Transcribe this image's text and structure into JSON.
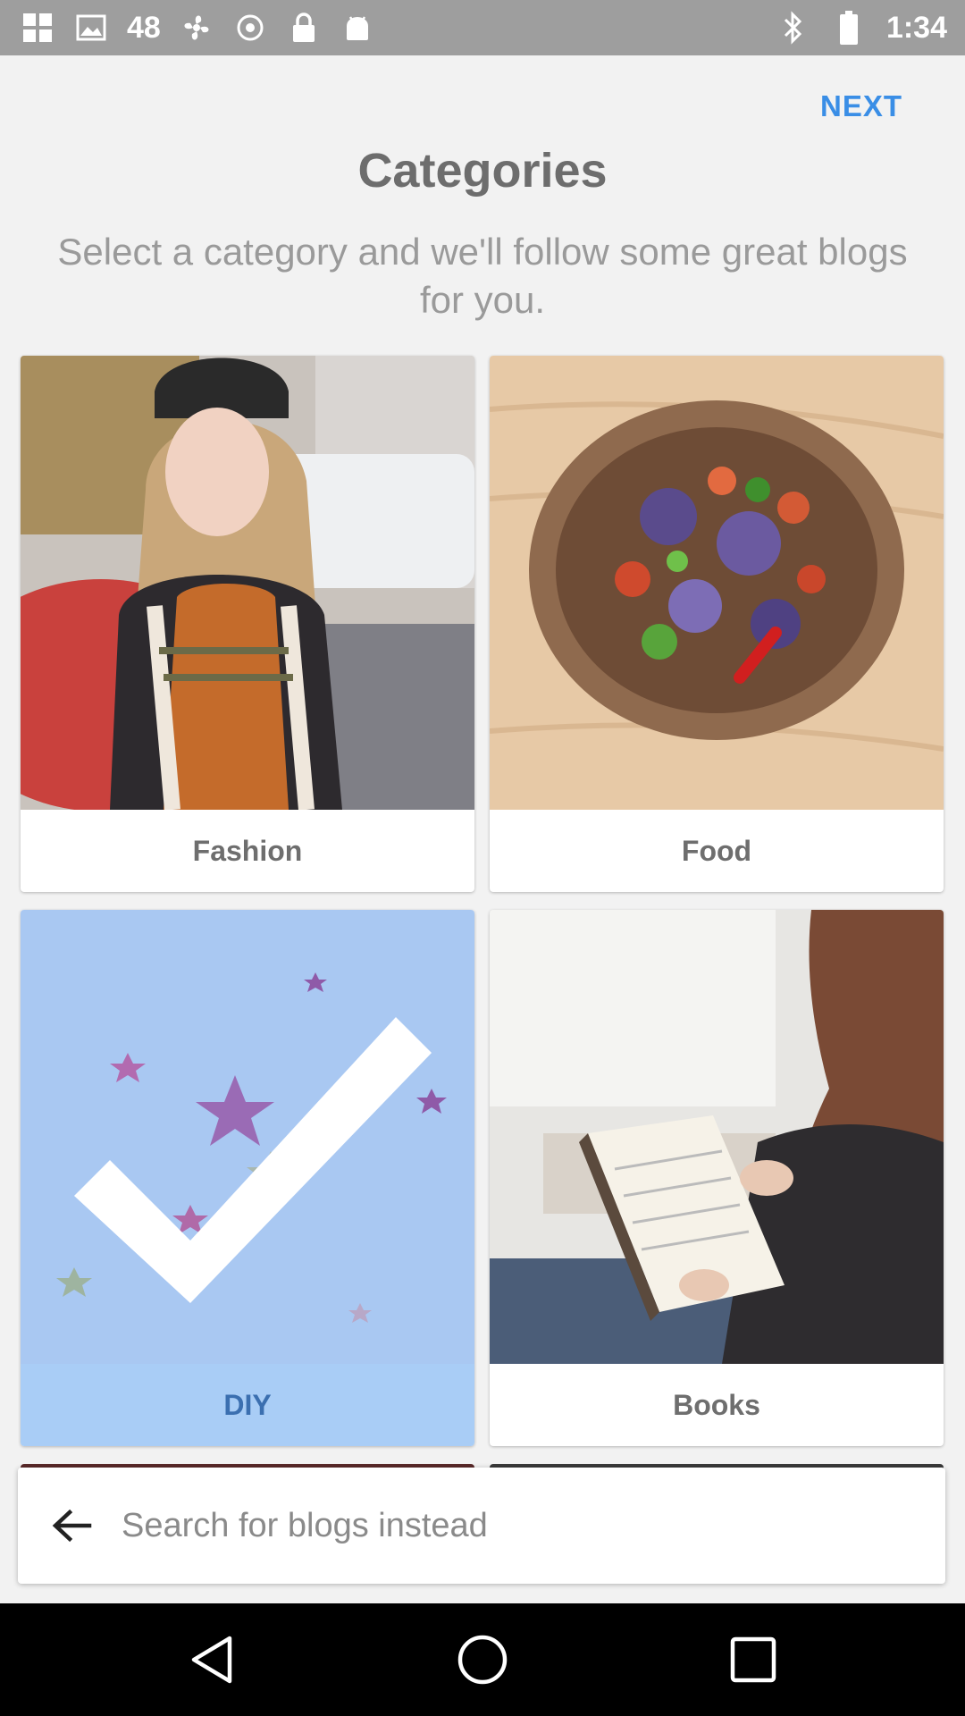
{
  "status_bar": {
    "left_text": "48",
    "time": "1:34",
    "icons": [
      "grid-icon",
      "picture-icon",
      "fan-icon",
      "location-icon",
      "lock-icon",
      "android-icon",
      "bluetooth-icon",
      "battery-icon"
    ]
  },
  "header": {
    "next_label": "NEXT",
    "title": "Categories",
    "subtitle": "Select a category and we'll follow some great blogs for you."
  },
  "categories": [
    {
      "label": "Fashion",
      "selected": false
    },
    {
      "label": "Food",
      "selected": false
    },
    {
      "label": "DIY",
      "selected": true
    },
    {
      "label": "Books",
      "selected": false
    }
  ],
  "search": {
    "placeholder": "Search for blogs instead"
  },
  "colors": {
    "accent": "#3a8ee6",
    "selected_bg": "#a9cdf6",
    "status_bar": "#9e9e9e"
  }
}
